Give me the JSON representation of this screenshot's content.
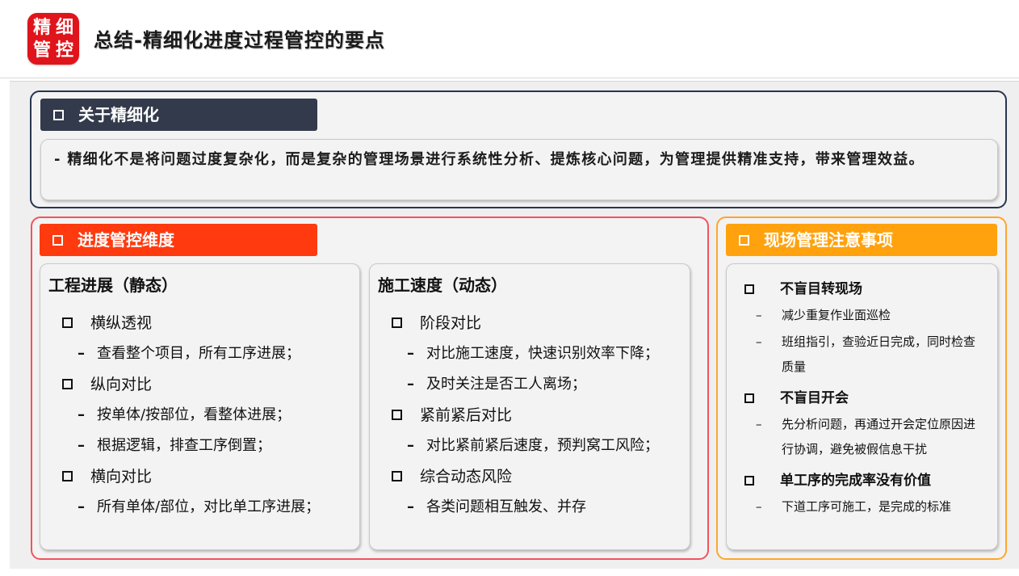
{
  "header": {
    "logo_chars": [
      "精",
      "细",
      "管",
      "控"
    ],
    "title": "总结-精细化进度过程管控的要点"
  },
  "section_top": {
    "tag": "关于精细化",
    "text": "- 精细化不是将问题过度复杂化，而是复杂的管理场景进行系统性分析、提炼核心问题，为管理提供精准支持，带来管理效益。"
  },
  "section_left": {
    "tag": "进度管控维度",
    "columns": [
      {
        "title": "工程进展（静态）",
        "groups": [
          {
            "label": "横纵透视",
            "subs": [
              "查看整个项目，所有工序进展；"
            ]
          },
          {
            "label": "纵向对比",
            "subs": [
              "按单体/按部位，看整体进展；",
              "根据逻辑，排查工序倒置；"
            ]
          },
          {
            "label": "横向对比",
            "subs": [
              "所有单体/部位，对比单工序进展；"
            ]
          }
        ]
      },
      {
        "title": "施工速度（动态）",
        "groups": [
          {
            "label": "阶段对比",
            "subs": [
              "对比施工速度，快速识别效率下降；",
              "及时关注是否工人离场；"
            ]
          },
          {
            "label": "紧前紧后对比",
            "subs": [
              "对比紧前紧后速度，预判窝工风险；"
            ]
          },
          {
            "label": "综合动态风险",
            "subs": [
              "各类问题相互触发、并存"
            ]
          }
        ]
      }
    ]
  },
  "section_right": {
    "tag": "现场管理注意事项",
    "groups": [
      {
        "label": "不盲目转现场",
        "subs": [
          "减少重复作业面巡检",
          "班组指引，查验近日完成，同时检查质量"
        ]
      },
      {
        "label": "不盲目开会",
        "subs": [
          "先分析问题，再通过开会定位原因进行协调，避免被假信息干扰"
        ]
      },
      {
        "label": "单工序的完成率没有价值",
        "subs": [
          "下道工序可施工，是完成的标准"
        ]
      }
    ]
  },
  "glyphs": {
    "dash": "–",
    "sub_dash": "–"
  },
  "colors": {
    "logo_red": "#e0141b",
    "tag_dark": "#323a4b",
    "tag_red": "#ff3a0f",
    "tag_orange": "#ffa20e",
    "border_navy": "#263550",
    "border_red": "#f2535f",
    "border_orange": "#ffa62b"
  }
}
